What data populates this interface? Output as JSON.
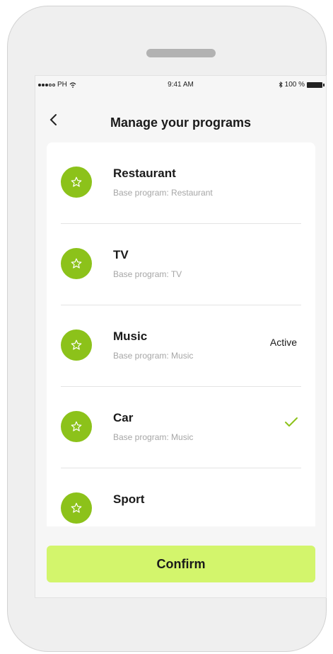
{
  "status_bar": {
    "carrier": "PH",
    "time": "9:41 AM",
    "battery": "100 %"
  },
  "header": {
    "back_icon": "chevron-left-icon",
    "title": "Manage your programs"
  },
  "programs": [
    {
      "name": "Restaurant",
      "base": "Base program: Restaurant"
    },
    {
      "name": "TV",
      "base": "Base program: TV"
    },
    {
      "name": "Music",
      "base": "Base program: Music",
      "status": "Active"
    },
    {
      "name": "Car",
      "base": "Base program: Music",
      "selected": true
    },
    {
      "name": "Sport"
    }
  ],
  "footer": {
    "confirm_label": "Confirm"
  },
  "colors": {
    "accent_green": "#8cc21a",
    "confirm_bg": "#d3f56c",
    "check": "#8cc21a"
  }
}
